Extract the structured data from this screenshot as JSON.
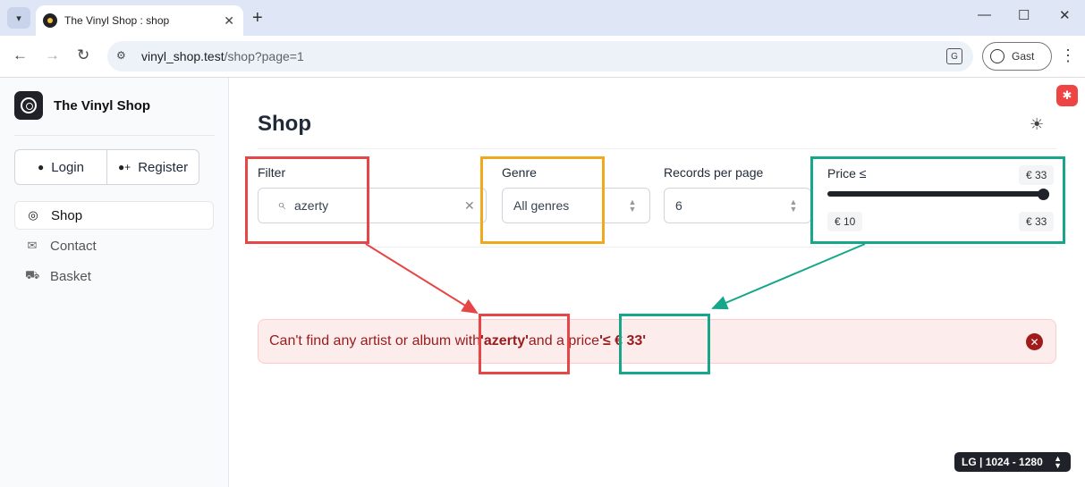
{
  "browser": {
    "tab_title": "The Vinyl Shop : shop",
    "url_host": "vinyl_shop.test",
    "url_path": "/shop?page=1",
    "profile_label": "Gast"
  },
  "sidebar": {
    "brand": "The Vinyl Shop",
    "auth": {
      "login": "Login",
      "register": "Register"
    },
    "nav": [
      {
        "label": "Shop",
        "icon": "vinyl-icon",
        "active": true
      },
      {
        "label": "Contact",
        "icon": "mail-icon",
        "active": false
      },
      {
        "label": "Basket",
        "icon": "cart-icon",
        "active": false
      }
    ]
  },
  "main": {
    "title": "Shop",
    "filter": {
      "label": "Filter",
      "value": "azerty"
    },
    "genre": {
      "label": "Genre",
      "value": "All genres"
    },
    "per_page": {
      "label": "Records per page",
      "value": "6"
    },
    "price": {
      "label": "Price ≤",
      "current": "€ 33",
      "min": "€ 10",
      "max": "€ 33",
      "level": 1.0
    },
    "alert": {
      "prefix": "Can't find any artist or album with ",
      "query": "'azerty'",
      "middle": " and a price ",
      "price": "'≤ € 33'"
    },
    "breakpoint": "LG | 1024 - 1280"
  },
  "colors": {
    "annotation_red": "#e64646",
    "annotation_amber": "#f0a81c",
    "annotation_green": "#16a68a",
    "alert_bg": "#fdecec",
    "alert_text": "#991b1b"
  }
}
